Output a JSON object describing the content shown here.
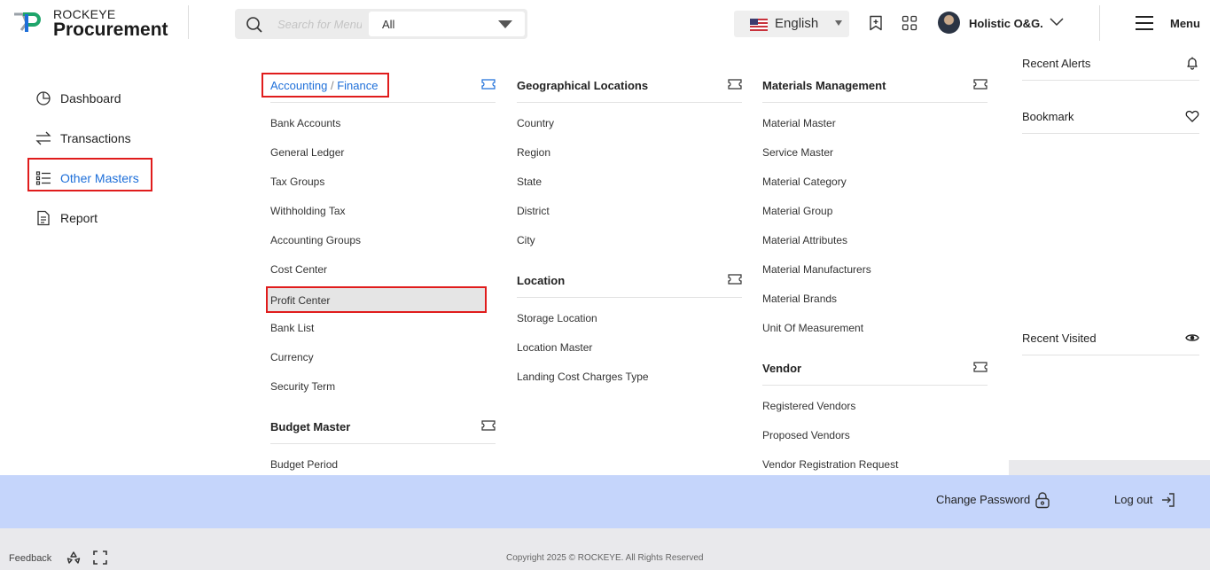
{
  "header": {
    "brand_small": "ROCKEYE",
    "brand_big": "Procurement",
    "search_placeholder": "Search for Menu",
    "search_scope": "All",
    "language": "English",
    "user_name": "Holistic O&G.",
    "menu_label": "Menu"
  },
  "sidebar": {
    "items": [
      {
        "label": "Dashboard",
        "icon": "dashboard-icon"
      },
      {
        "label": "Transactions",
        "icon": "transactions-icon"
      },
      {
        "label": "Other Masters",
        "icon": "list-icon",
        "active": true
      },
      {
        "label": "Report",
        "icon": "report-icon"
      }
    ]
  },
  "mega_menu": {
    "col1": {
      "accounting_parent": "Accounting",
      "accounting_sep": "/",
      "accounting_child": "Finance",
      "accounting_items": [
        "Bank Accounts",
        "General Ledger",
        "Tax Groups",
        "Withholding Tax",
        "Accounting Groups",
        "Cost Center",
        "Profit Center",
        "Bank List",
        "Currency",
        "Security Term"
      ],
      "budget_title": "Budget Master",
      "budget_items": [
        "Budget Period"
      ]
    },
    "col2": {
      "geo_title": "Geographical Locations",
      "geo_items": [
        "Country",
        "Region",
        "State",
        "District",
        "City"
      ],
      "location_title": "Location",
      "location_items": [
        "Storage Location",
        "Location Master",
        "Landing Cost Charges Type"
      ]
    },
    "col3": {
      "materials_title": "Materials Management",
      "materials_items": [
        "Material Master",
        "Service Master",
        "Material Category",
        "Material Group",
        "Material Attributes",
        "Material Manufacturers",
        "Material Brands",
        "Unit Of Measurement"
      ],
      "vendor_title": "Vendor",
      "vendor_items": [
        "Registered Vendors",
        "Proposed Vendors",
        "Vendor Registration Request"
      ]
    }
  },
  "right_panel": {
    "recent_alerts": "Recent Alerts",
    "bookmark": "Bookmark",
    "recent_visited": "Recent Visited"
  },
  "bottom_bar": {
    "change_password": "Change Password",
    "log_out": "Log out"
  },
  "footer": {
    "feedback": "Feedback",
    "copyright": "Copyright 2025 © ROCKEYE. All Rights Reserved"
  },
  "colors": {
    "accent_blue": "#1e6fd9",
    "highlight_red": "#e01c1c",
    "bottom_bar": "#c5d5fb"
  }
}
